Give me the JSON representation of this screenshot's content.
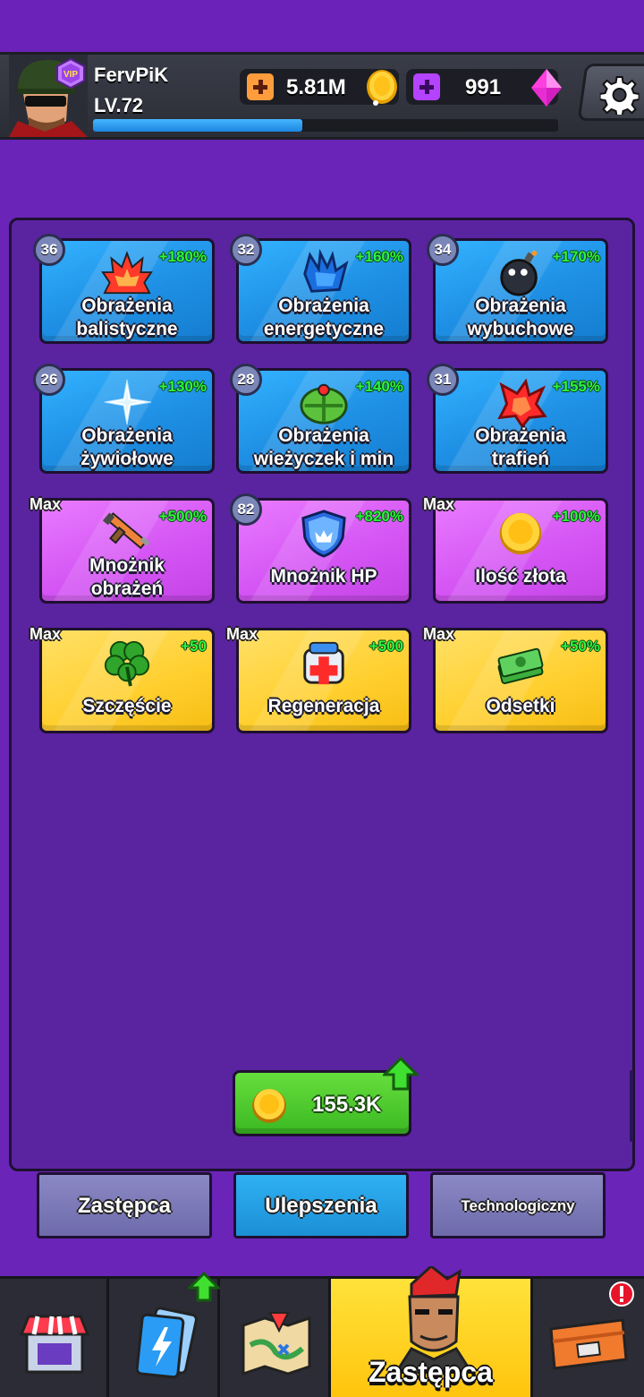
{
  "player": {
    "name": "FervPiK",
    "level": "LV.72",
    "vip_label": "VIP",
    "xp_progress": 0.45
  },
  "resources": {
    "gold": "5.81M",
    "gems": "991"
  },
  "upgrades": [
    {
      "level": "36",
      "bonus": "+180%",
      "label_line1": "Obrażenia",
      "label_line2": "balistyczne",
      "color": "blue",
      "icon": "fire-burst-icon"
    },
    {
      "level": "32",
      "bonus": "+160%",
      "label_line1": "Obrażenia",
      "label_line2": "energetyczne",
      "color": "blue",
      "icon": "energy-claw-icon"
    },
    {
      "level": "34",
      "bonus": "+170%",
      "label_line1": "Obrażenia",
      "label_line2": "wybuchowe",
      "color": "blue",
      "icon": "bomb-icon"
    },
    {
      "level": "26",
      "bonus": "+130%",
      "label_line1": "Obrażenia",
      "label_line2": "żywiołowe",
      "color": "blue",
      "icon": "sparkle-icon"
    },
    {
      "level": "28",
      "bonus": "+140%",
      "label_line1": "Obrażenia",
      "label_line2": "wieżyczek i min",
      "color": "blue",
      "icon": "landmine-icon"
    },
    {
      "level": "31",
      "bonus": "+155%",
      "label_line1": "Obrażenia",
      "label_line2": "trafień",
      "color": "blue",
      "icon": "hit-burst-icon"
    },
    {
      "level": "Max",
      "bonus": "+500%",
      "label_line1": "Mnożnik",
      "label_line2": "obrażeń",
      "color": "pink",
      "icon": "rifle-icon"
    },
    {
      "level": "82",
      "bonus": "+820%",
      "label_line1": "Mnożnik HP",
      "label_line2": "",
      "color": "pink",
      "icon": "shield-icon"
    },
    {
      "level": "Max",
      "bonus": "+100%",
      "label_line1": "Ilość złota",
      "label_line2": "",
      "color": "pink",
      "icon": "gold-coin-icon"
    },
    {
      "level": "Max",
      "bonus": "+50",
      "label_line1": "Szczęście",
      "label_line2": "",
      "color": "gold",
      "icon": "clover-icon"
    },
    {
      "level": "Max",
      "bonus": "+500",
      "label_line1": "Regeneracja",
      "label_line2": "",
      "color": "gold",
      "icon": "medkit-icon"
    },
    {
      "level": "Max",
      "bonus": "+50%",
      "label_line1": "Odsetki",
      "label_line2": "",
      "color": "gold",
      "icon": "cash-stack-icon"
    }
  ],
  "upgrade_button": {
    "cost": "155.3K"
  },
  "tabs": [
    {
      "label": "Zastępca",
      "active": false
    },
    {
      "label": "Ulepszenia",
      "active": true
    },
    {
      "label": "Technologiczny",
      "active": false
    }
  ],
  "bottom_nav": [
    {
      "icon": "shop-icon"
    },
    {
      "icon": "cards-icon"
    },
    {
      "icon": "map-icon"
    },
    {
      "label": "Zastępca",
      "icon": "hero-portrait-icon",
      "active": true
    },
    {
      "icon": "crate-icon"
    }
  ]
}
